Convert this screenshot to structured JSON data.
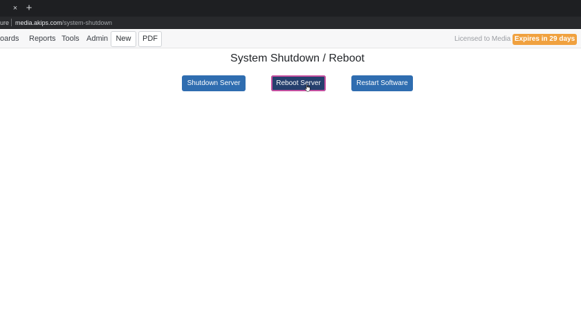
{
  "browser": {
    "tab_close_glyph": "×",
    "new_tab_glyph": "+",
    "security_label": "ure",
    "url_host": "media.akips.com",
    "url_path": "/system-shutdown"
  },
  "nav": {
    "items": [
      "oards",
      "Reports",
      "Tools",
      "Admin"
    ],
    "buttons": [
      "New",
      "PDF"
    ],
    "licensed": "Licensed to Media",
    "expires": "Expires in 29 days",
    "expires_color": "#f0a13f"
  },
  "main": {
    "title": "System Shutdown / Reboot",
    "actions": [
      {
        "label": "Shutdown Server"
      },
      {
        "label": "Reboot Server",
        "state": "hover-focus"
      },
      {
        "label": "Restart Software"
      }
    ],
    "button_color": "#2f6db0",
    "active_button_color": "#253f6d"
  },
  "icons": [
    "close-icon",
    "plus-icon",
    "hand-pointer-icon"
  ]
}
